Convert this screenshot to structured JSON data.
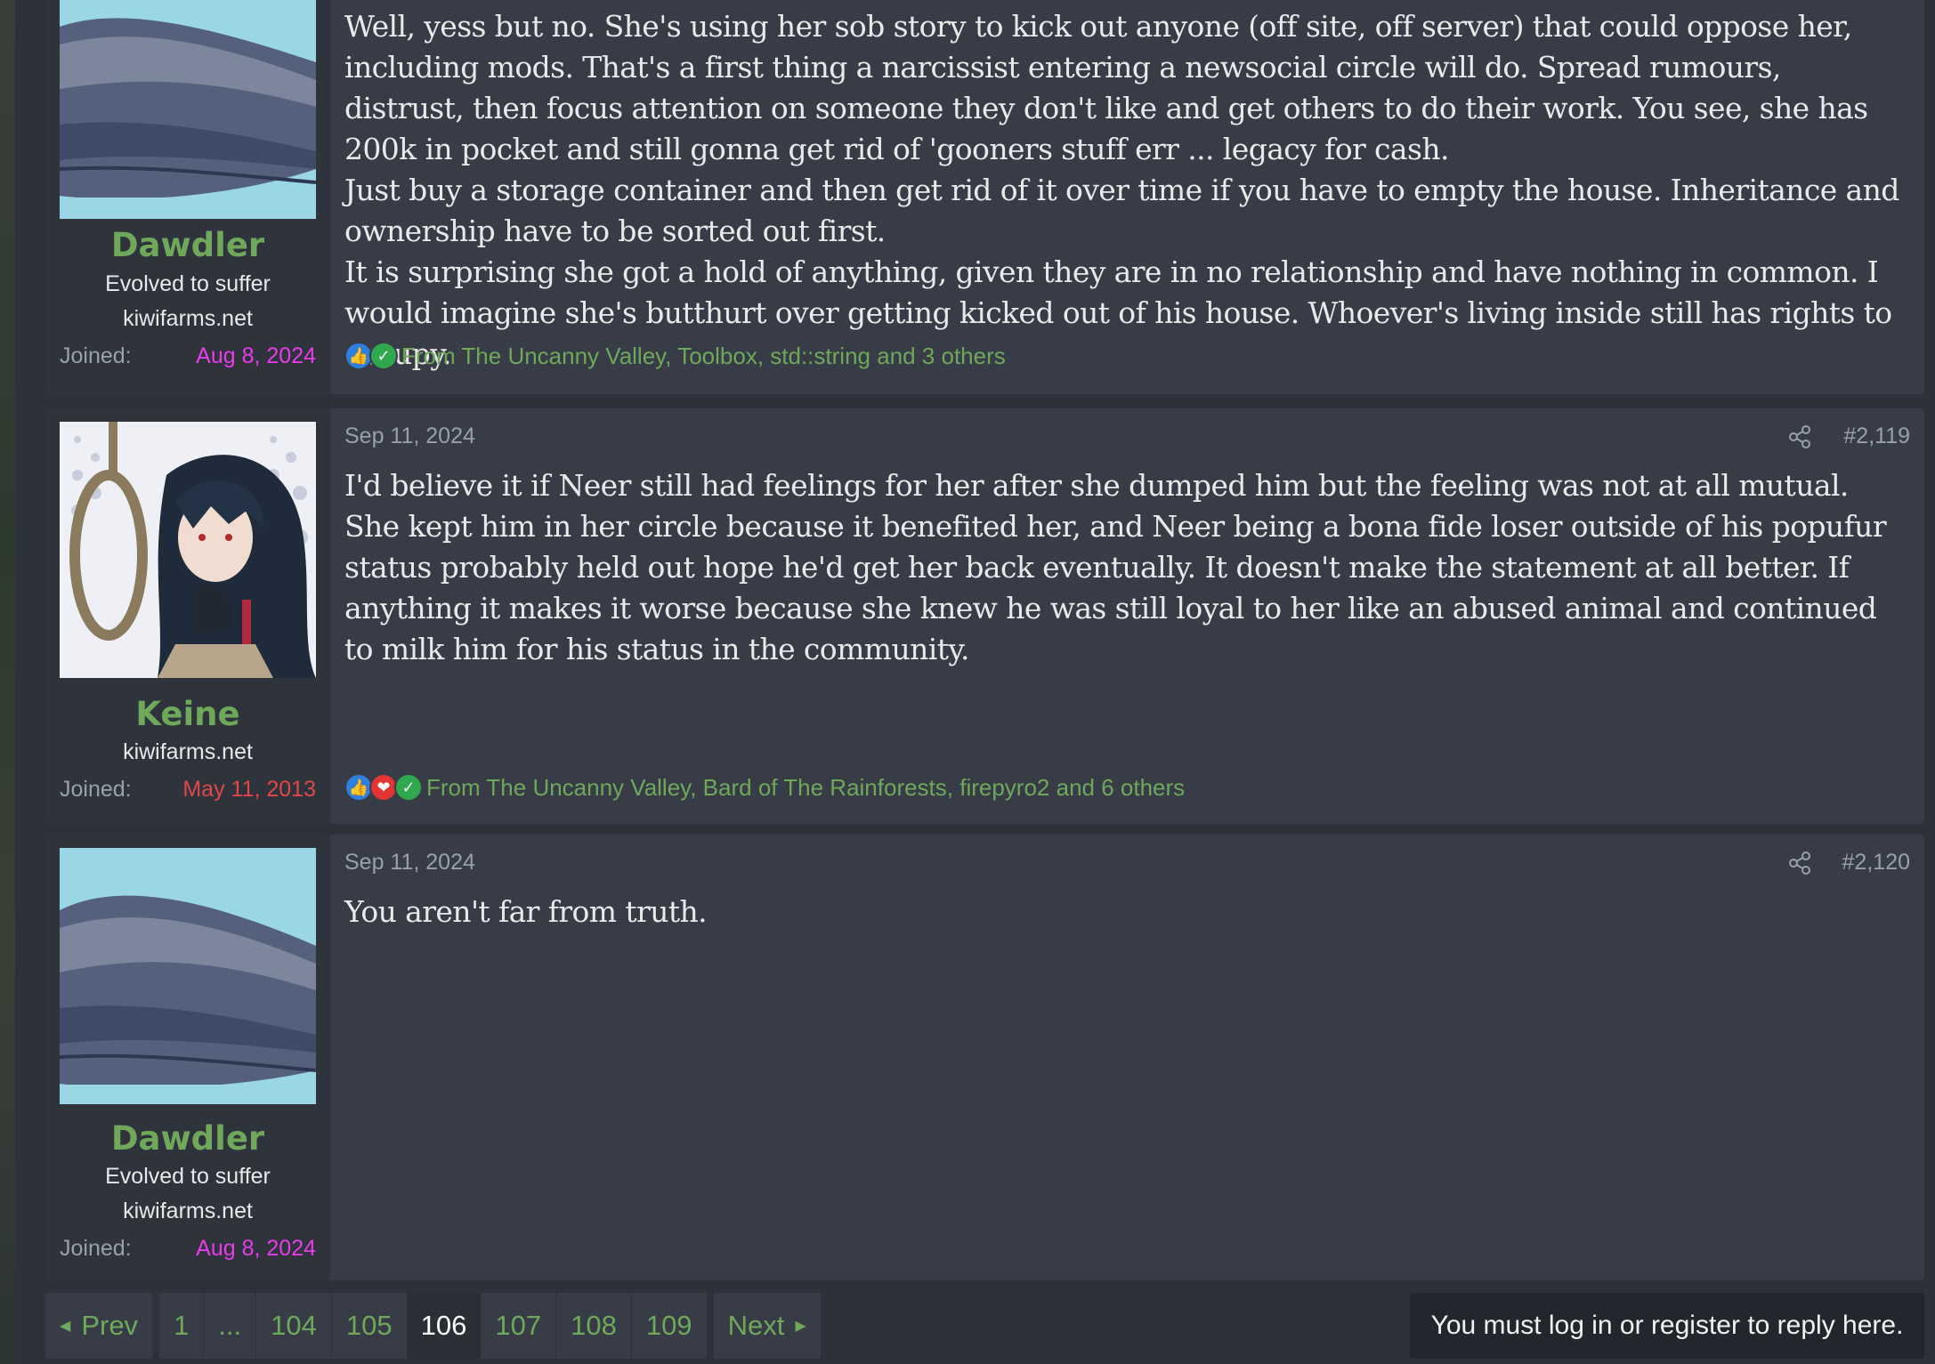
{
  "posts": [
    {
      "username": "Dawdler",
      "user_title": "Evolved to suffer",
      "user_site": "kiwifarms.net",
      "joined_label": "Joined:",
      "joined_date": "Aug 8, 2024",
      "joined_color": "#e83ce8",
      "avatar": "whale-avatar",
      "message": [
        "Well, yess but no. She's using her sob story to kick out anyone (off site, off server) that could oppose her, including mods. That's a first thing a narcissist entering a newsocial circle will do. Spread rumours, distrust, then focus attention on someone they don't like and get others to do their work. You see, she has 200k in pocket and still gonna get rid of 'gooners stuff err ... legacy for cash.",
        "Just buy a storage container and then get rid of it over time if you have to empty the house. Inheritance and ownership have to be sorted out first.",
        "It is surprising she got a hold of anything, given they are in no relationship and have nothing in common. I would imagine she's butthurt over getting kicked out of his house. Whoever's living inside still has rights to occupy."
      ],
      "reactions_text": "From The Uncanny Valley, Toolbox, std::string and 3 others",
      "reaction_icons": [
        "like-icon",
        "check-icon"
      ]
    },
    {
      "username": "Keine",
      "user_site": "kiwifarms.net",
      "joined_label": "Joined:",
      "joined_date": "May 11, 2013",
      "joined_color": "#e04848",
      "avatar": "noose-anime-avatar",
      "date": "Sep 11, 2024",
      "post_number": "#2,119",
      "message": [
        "I'd believe it if Neer still had feelings for her after she dumped him but the feeling was not at all mutual. She kept him in her circle because it benefited her, and Neer being a bona fide loser outside of his popufur status probably held out hope he'd get her back eventually. It doesn't make the statement at all better. If anything it makes it worse because she knew he was still loyal to her like an abused animal and continued to milk him for his status in the community."
      ],
      "reactions_text": "From The Uncanny Valley, Bard of The Rainforests, firepyro2 and 6 others",
      "reaction_icons": [
        "like-icon",
        "heart-icon",
        "check-icon"
      ]
    },
    {
      "username": "Dawdler",
      "user_title": "Evolved to suffer",
      "user_site": "kiwifarms.net",
      "joined_label": "Joined:",
      "joined_date": "Aug 8, 2024",
      "joined_color": "#e83ce8",
      "avatar": "whale-avatar",
      "date": "Sep 11, 2024",
      "post_number": "#2,120",
      "message": [
        "You aren't far from truth."
      ]
    }
  ],
  "pagination": {
    "prev": "Prev",
    "next": "Next",
    "pages": [
      "1",
      "...",
      "104",
      "105",
      "106",
      "107",
      "108",
      "109"
    ],
    "current": "106"
  },
  "reply_notice": "You must log in or register to reply here.",
  "colors": {
    "username": "#6fa85a",
    "link": "#6fa85a",
    "background": "#2d3139",
    "post_bg": "#373c46"
  }
}
